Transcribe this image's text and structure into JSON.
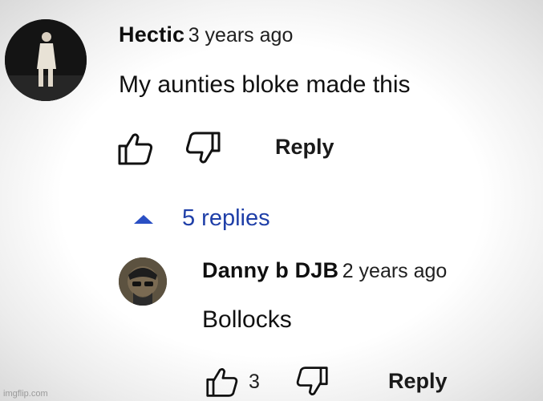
{
  "comment": {
    "author": "Hectic",
    "time": "3 years ago",
    "text": "My aunties bloke made this",
    "reply_label": "Reply"
  },
  "replies_toggle": {
    "label": "5 replies",
    "accent": "#2a4fc4"
  },
  "reply": {
    "author": "Danny b DJB",
    "time": "2 years ago",
    "text": "Bollocks",
    "like_count": "3",
    "reply_label": "Reply"
  },
  "watermark": "imgflip.com",
  "icons": [
    "thumbs-up-icon",
    "thumbs-down-icon",
    "caret-up-icon"
  ]
}
